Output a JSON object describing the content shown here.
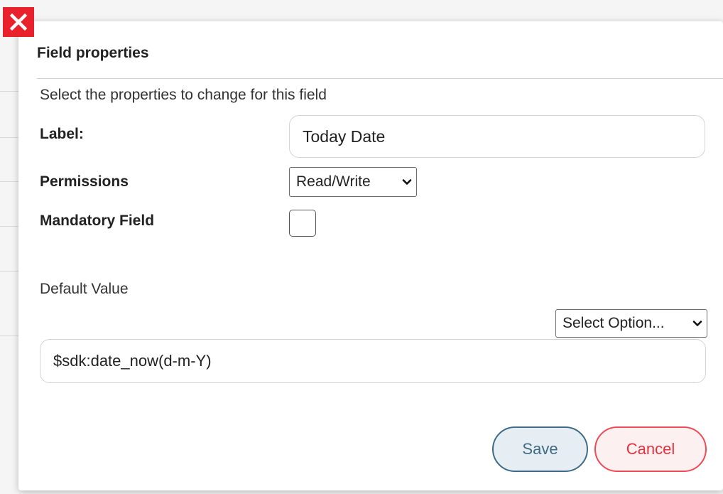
{
  "dialog": {
    "title": "Field properties",
    "subtitle": "Select the properties to change for this field",
    "close_icon": "close-icon",
    "colors": {
      "close_bg": "#e8212c",
      "save_border": "#3f6b85",
      "cancel_border": "#ef4b57"
    }
  },
  "form": {
    "label": {
      "caption": "Label:",
      "value": "Today Date"
    },
    "permissions": {
      "caption": "Permissions",
      "selected": "Read/Write"
    },
    "mandatory": {
      "caption": "Mandatory Field",
      "checked": false
    },
    "default_value": {
      "caption": "Default Value",
      "option_select": "Select Option...",
      "value": "$sdk:date_now(d-m-Y)"
    }
  },
  "buttons": {
    "save": "Save",
    "cancel": "Cancel"
  }
}
